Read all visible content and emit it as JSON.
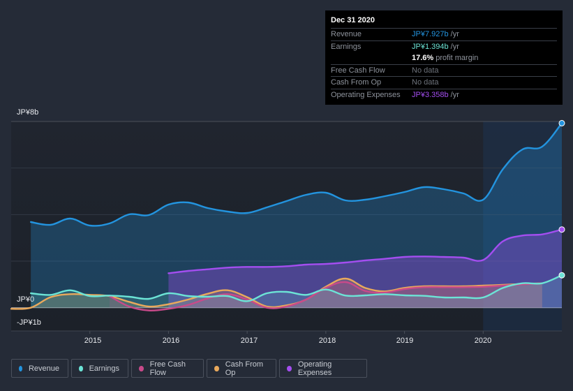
{
  "tooltip": {
    "date": "Dec 31 2020",
    "rows": [
      {
        "label": "Revenue",
        "value": "JP¥7.927b",
        "unit": " /yr",
        "color": "#2394df"
      },
      {
        "label": "Earnings",
        "value": "JP¥1.394b",
        "unit": " /yr",
        "color": "#6ce4d6"
      },
      {
        "label": "",
        "value": "17.6%",
        "unit": " profit margin",
        "color": "#ffffff"
      },
      {
        "label": "Free Cash Flow",
        "value": "No data",
        "unit": "",
        "color": "#8e939c"
      },
      {
        "label": "Cash From Op",
        "value": "No data",
        "unit": "",
        "color": "#8e939c"
      },
      {
        "label": "Operating Expenses",
        "value": "JP¥3.358b",
        "unit": " /yr",
        "color": "#a44ef0"
      }
    ]
  },
  "legend": [
    {
      "label": "Revenue",
      "color": "#2394df"
    },
    {
      "label": "Earnings",
      "color": "#6ce4d6"
    },
    {
      "label": "Free Cash Flow",
      "color": "#c84a8a"
    },
    {
      "label": "Cash From Op",
      "color": "#e9a95c"
    },
    {
      "label": "Operating Expenses",
      "color": "#a44ef0"
    }
  ],
  "chart_data": {
    "type": "area",
    "title": "",
    "xlabel": "",
    "ylabel": "",
    "y_tick_labels": [
      {
        "value": 8,
        "label": "JP¥8b"
      },
      {
        "value": 0,
        "label": "JP¥0"
      },
      {
        "value": -1,
        "label": "-JP¥1b"
      }
    ],
    "x_tick_labels": [
      {
        "value": 2015,
        "label": "2015"
      },
      {
        "value": 2016,
        "label": "2016"
      },
      {
        "value": 2017,
        "label": "2017"
      },
      {
        "value": 2018,
        "label": "2018"
      },
      {
        "value": 2019,
        "label": "2019"
      },
      {
        "value": 2020,
        "label": "2020"
      }
    ],
    "xlim": [
      2014.0,
      2021.0
    ],
    "ylim": [
      -1,
      8
    ],
    "grid": true,
    "legend_position": "bottom",
    "highlight_from": 2020.0,
    "units": "JP¥ billions",
    "series": [
      {
        "name": "Revenue",
        "color": "#2394df",
        "x": [
          2014.25,
          2014.5,
          2014.75,
          2015.0,
          2015.25,
          2015.5,
          2015.75,
          2016.0,
          2016.25,
          2016.5,
          2016.75,
          2017.0,
          2017.25,
          2017.5,
          2017.75,
          2018.0,
          2018.25,
          2018.5,
          2018.75,
          2019.0,
          2019.25,
          2019.5,
          2019.75,
          2020.0,
          2020.25,
          2020.5,
          2020.75,
          2021.0
        ],
        "values": [
          3.68,
          3.56,
          3.83,
          3.53,
          3.62,
          4.01,
          3.98,
          4.43,
          4.52,
          4.28,
          4.13,
          4.07,
          4.31,
          4.58,
          4.85,
          4.94,
          4.61,
          4.64,
          4.79,
          4.97,
          5.18,
          5.09,
          4.91,
          4.64,
          5.95,
          6.8,
          6.92,
          7.927
        ]
      },
      {
        "name": "Earnings",
        "color": "#6ce4d6",
        "x": [
          2014.25,
          2014.5,
          2014.75,
          2015.0,
          2015.25,
          2015.5,
          2015.75,
          2016.0,
          2016.25,
          2016.5,
          2016.75,
          2017.0,
          2017.25,
          2017.5,
          2017.75,
          2018.0,
          2018.25,
          2018.5,
          2018.75,
          2019.0,
          2019.25,
          2019.5,
          2019.75,
          2020.0,
          2020.25,
          2020.5,
          2020.75,
          2021.0
        ],
        "values": [
          0.62,
          0.55,
          0.75,
          0.5,
          0.52,
          0.47,
          0.38,
          0.62,
          0.5,
          0.47,
          0.5,
          0.28,
          0.62,
          0.68,
          0.55,
          0.78,
          0.52,
          0.53,
          0.58,
          0.53,
          0.51,
          0.44,
          0.44,
          0.44,
          0.85,
          1.05,
          1.05,
          1.394
        ]
      },
      {
        "name": "Free Cash Flow",
        "color": "#c84a8a",
        "x": [
          2015.25,
          2015.5,
          2015.75,
          2016.0,
          2016.25,
          2016.5,
          2016.75,
          2017.0,
          2017.25,
          2017.5,
          2017.75,
          2018.0,
          2018.25,
          2018.5,
          2018.75,
          2019.0,
          2019.25,
          2019.5,
          2019.75,
          2020.0,
          2020.25,
          2020.5,
          2020.75
        ],
        "values": [
          0.5,
          0.05,
          -0.12,
          -0.05,
          0.12,
          0.4,
          0.58,
          0.35,
          0.0,
          0.05,
          0.35,
          0.85,
          1.1,
          0.72,
          0.65,
          0.8,
          0.88,
          0.88,
          0.88,
          0.9,
          0.95,
          1.0,
          1.05
        ]
      },
      {
        "name": "Cash From Op",
        "color": "#e9a95c",
        "x": [
          2014.0,
          2014.25,
          2014.5,
          2014.75,
          2015.0,
          2015.25,
          2015.5,
          2015.75,
          2016.0,
          2016.25,
          2016.5,
          2016.75,
          2017.0,
          2017.25,
          2017.5,
          2017.75,
          2018.0,
          2018.25,
          2018.5,
          2018.75,
          2019.0,
          2019.25,
          2019.5,
          2019.75,
          2020.0,
          2020.25,
          2020.5,
          2020.75
        ],
        "values": [
          -0.05,
          0.0,
          0.45,
          0.58,
          0.55,
          0.5,
          0.25,
          0.05,
          0.15,
          0.35,
          0.6,
          0.75,
          0.45,
          0.05,
          0.1,
          0.35,
          0.9,
          1.25,
          0.85,
          0.7,
          0.85,
          0.92,
          0.92,
          0.92,
          0.95,
          0.98,
          1.02,
          1.05
        ]
      },
      {
        "name": "Operating Expenses",
        "color": "#a44ef0",
        "x": [
          2016.0,
          2016.25,
          2016.5,
          2016.75,
          2017.0,
          2017.25,
          2017.5,
          2017.75,
          2018.0,
          2018.25,
          2018.5,
          2018.75,
          2019.0,
          2019.25,
          2019.5,
          2019.75,
          2020.0,
          2020.25,
          2020.5,
          2020.75,
          2021.0
        ],
        "values": [
          1.48,
          1.58,
          1.65,
          1.72,
          1.75,
          1.75,
          1.78,
          1.85,
          1.88,
          1.94,
          2.03,
          2.1,
          2.18,
          2.2,
          2.18,
          2.15,
          2.05,
          2.85,
          3.1,
          3.15,
          3.358
        ]
      }
    ]
  }
}
